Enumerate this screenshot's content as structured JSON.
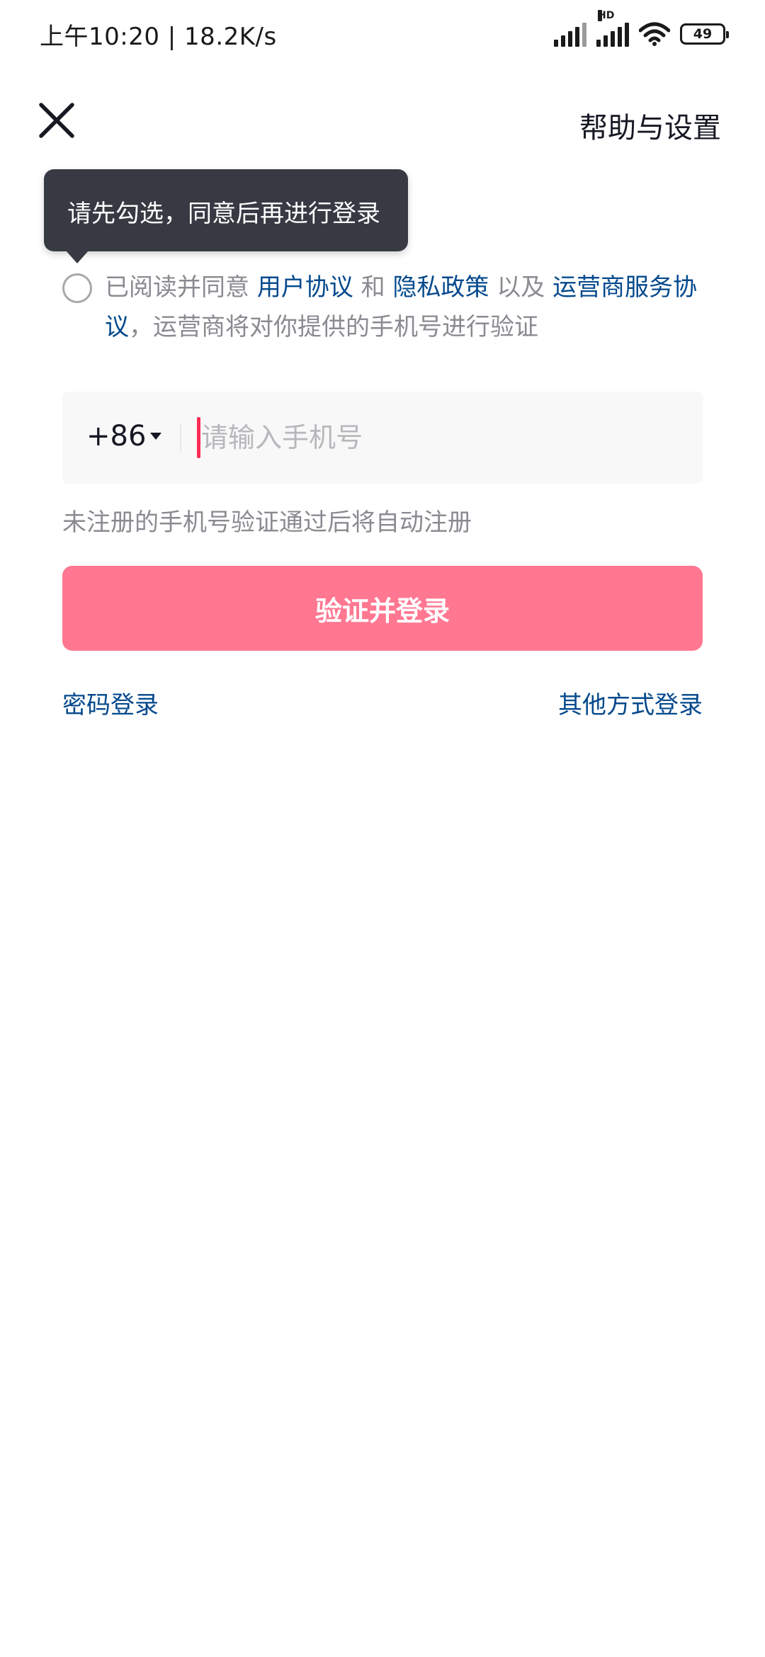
{
  "status_bar": {
    "time_speed": "上午10:20 | 18.2K/s",
    "network_label": "HD",
    "battery": "49"
  },
  "header": {
    "close_icon": "close-icon",
    "help_label": "帮助与设置"
  },
  "tooltip": {
    "text": "请先勾选，同意后再进行登录"
  },
  "agreement": {
    "prefix": "已阅读并同意 ",
    "link_user": "用户协议",
    "and": " 和 ",
    "link_privacy": "隐私政策",
    "and2": " 以及 ",
    "link_carrier": "运营商服务协议",
    "suffix": "，运营商将对你提供的手机号进行验证"
  },
  "phone": {
    "country_code": "+86",
    "placeholder": "请输入手机号",
    "value": ""
  },
  "hint": "未注册的手机号验证通过后将自动注册",
  "submit_label": "验证并登录",
  "links": {
    "password_login": "密码登录",
    "other_login": "其他方式登录"
  },
  "colors": {
    "accent_button": "#ff7791",
    "link": "#04498d",
    "caret": "#fe2c55",
    "tooltip_bg": "#373a43"
  }
}
